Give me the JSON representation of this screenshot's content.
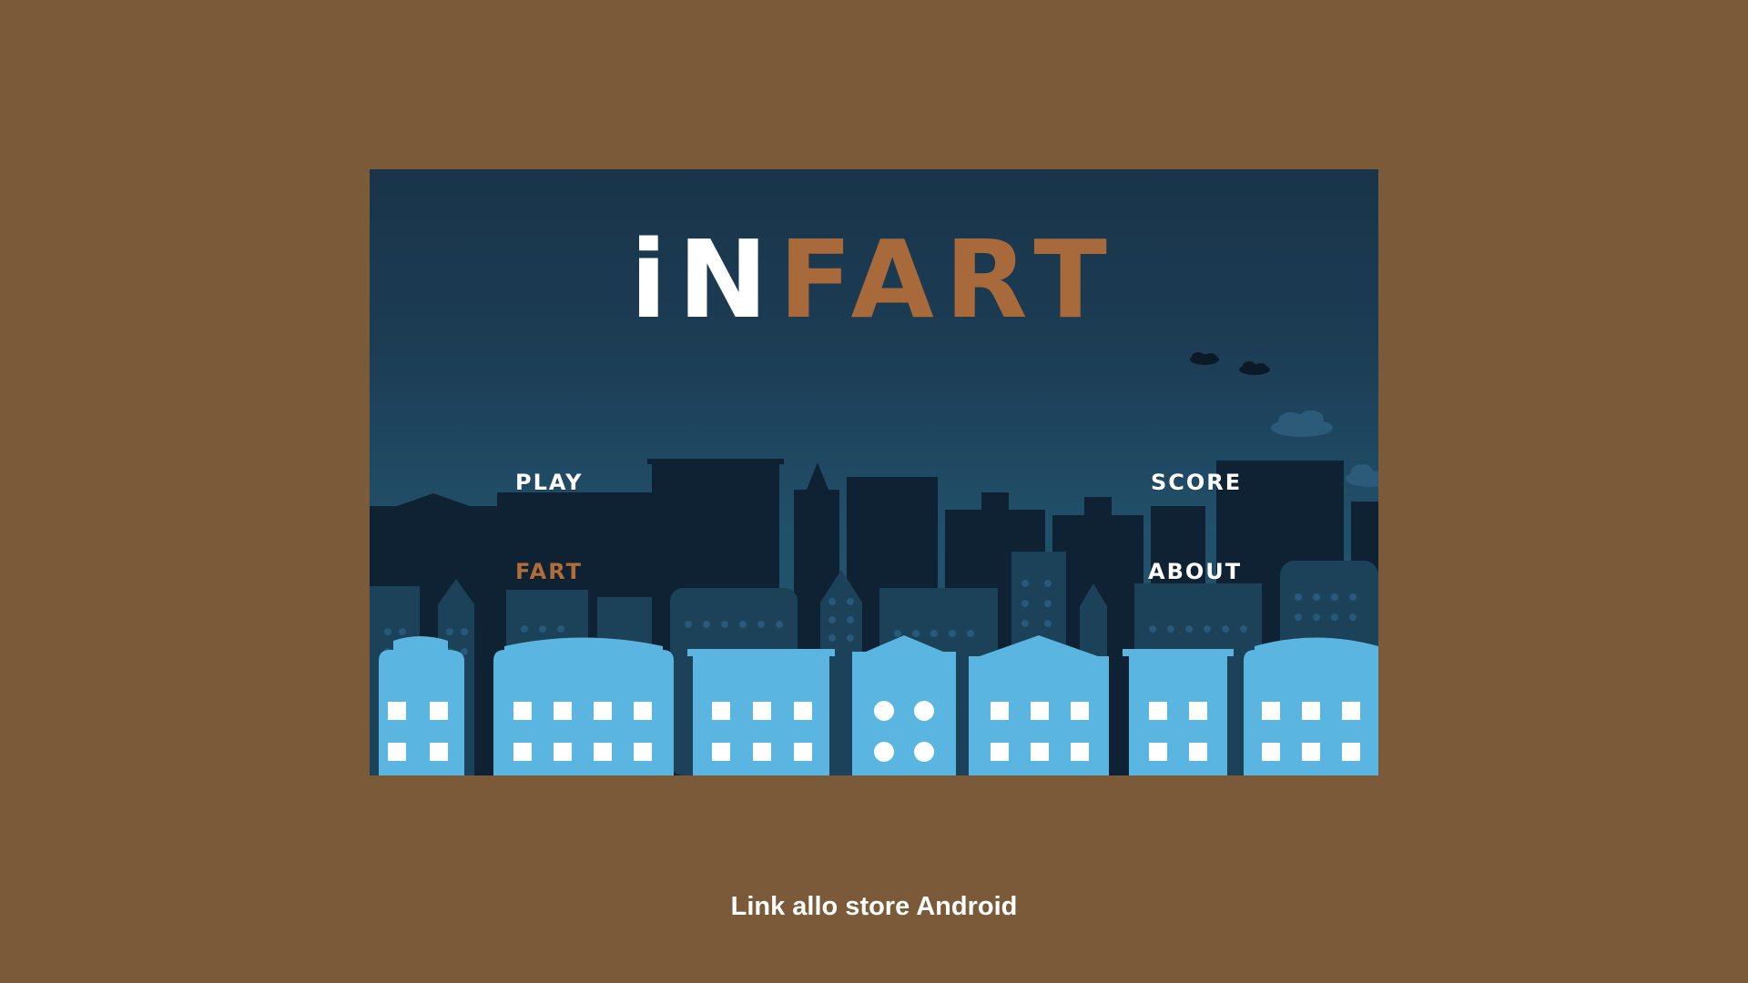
{
  "game": {
    "title_part_a": "iN",
    "title_part_b": "FART",
    "menu": {
      "play": "PLAY",
      "fart": "FART",
      "score": "SCORE",
      "about": "ABOUT"
    }
  },
  "footer": {
    "store_link": "Link allo store Android"
  },
  "colors": {
    "page_background": "#7a5a39",
    "sky": "#1c3d55",
    "accent_orange": "#a8693b",
    "building_front": "#5ab6e0",
    "building_back": "#0f2233"
  }
}
